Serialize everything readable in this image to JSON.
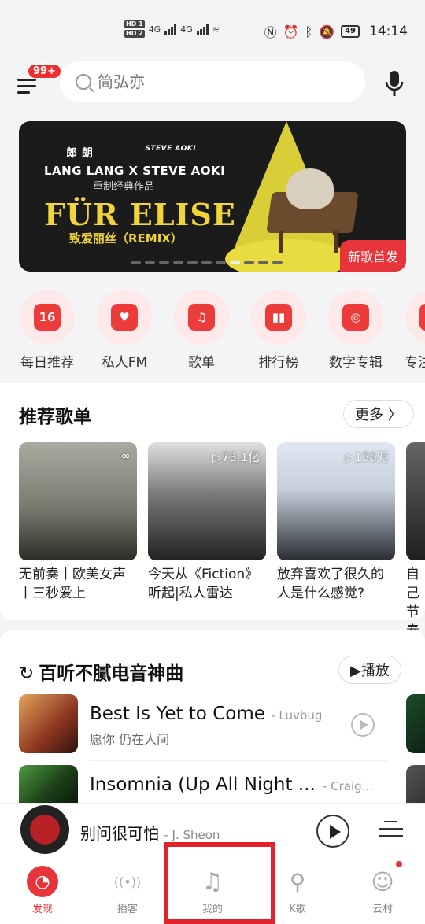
{
  "status_bar": {
    "time": "14:14",
    "battery": "49",
    "network": "4G"
  },
  "header": {
    "badge": "99+",
    "search_placeholder": "简弘亦"
  },
  "banner": {
    "artist_cn_1": "郎 朗",
    "artist_cn_2": "STEVE AOKI",
    "artists": "LANG LANG  X  STEVE AOKI",
    "subtitle": "重制经典作品",
    "title": "FÜR ELISE",
    "title_cn": "致爱丽丝（REMIX）",
    "tag": "新歌首发"
  },
  "quick_nav": [
    {
      "label": "每日推荐",
      "glyph": "16",
      "icon": "calendar-icon"
    },
    {
      "label": "私人FM",
      "glyph": "♥",
      "icon": "radio-icon"
    },
    {
      "label": "歌单",
      "glyph": "♫",
      "icon": "playlist-icon"
    },
    {
      "label": "排行榜",
      "glyph": "▮▮",
      "icon": "chart-icon"
    },
    {
      "label": "数字专辑",
      "glyph": "◎",
      "icon": "album-icon"
    },
    {
      "label": "专注",
      "glyph": "",
      "icon": "focus-icon"
    }
  ],
  "recommended": {
    "title": "推荐歌单",
    "more": "更多 〉",
    "playlists": [
      {
        "title": "无前奏丨欧美女声丨三秒爱上",
        "plays": "",
        "colors": [
          "#9fa39a",
          "#3e3b35"
        ]
      },
      {
        "title": "今天从《Fiction》听起|私人雷达",
        "plays": "▷73.1亿",
        "colors": [
          "#d6d6d6",
          "#333"
        ]
      },
      {
        "title": "放弃喜欢了很久的人是什么感觉?",
        "plays": "▷155万",
        "colors": [
          "#d8e2ee",
          "#2c2f36"
        ]
      },
      {
        "title": "自己节奏",
        "plays": "",
        "colors": [
          "#555",
          "#222"
        ]
      }
    ]
  },
  "songs_section": {
    "title": "百听不腻电音神曲",
    "play_all": "▶播放",
    "songs": [
      {
        "name": "Best Is Yet to Come",
        "artist": "- Luvbug",
        "sub": "愿你 仍在人间",
        "colors": [
          "#d88a4a",
          "#6d2b1e"
        ]
      },
      {
        "name": "Insomnia (Up All Night ...",
        "artist": "- Craig...",
        "sub": "",
        "colors": [
          "#3c7d3a",
          "#111"
        ]
      }
    ]
  },
  "player": {
    "song": "别问很可怕",
    "artist": "- J. Sheon"
  },
  "tabs": [
    {
      "label": "发现",
      "glyph": "◔",
      "active": true
    },
    {
      "label": "播客",
      "glyph": "((•))",
      "active": false
    },
    {
      "label": "我的",
      "glyph": "♫",
      "active": false
    },
    {
      "label": "K歌",
      "glyph": "⚲",
      "active": false
    },
    {
      "label": "云村",
      "glyph": "☺",
      "active": false
    }
  ],
  "colors": {
    "brand": "#e7343b",
    "highlight": "#e3212d"
  }
}
